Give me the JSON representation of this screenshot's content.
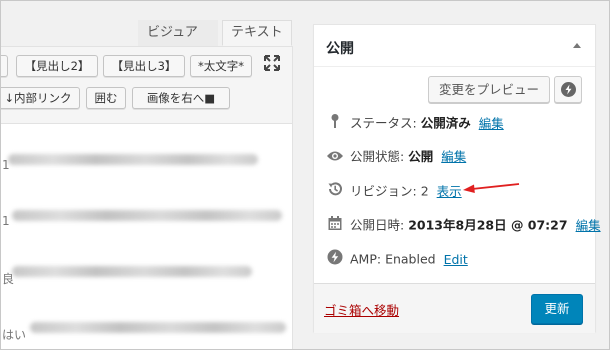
{
  "editor": {
    "tabs": [
      {
        "label": "ビジュアル"
      },
      {
        "label": "テキスト"
      }
    ],
    "quicktags": {
      "row1": [
        "【見出し2】",
        "【見出し3】",
        "*太文字*"
      ],
      "row2": [
        "↓内部リンク",
        "囲む",
        "画像を右へ■"
      ]
    },
    "content_fragments": [
      "1",
      "1",
      "良",
      "はい"
    ]
  },
  "publish_box": {
    "title": "公開",
    "preview_button": "変更をプレビュー",
    "status": {
      "label": "ステータス:",
      "value": "公開済み",
      "link": "編集"
    },
    "visibility": {
      "label": "公開状態:",
      "value": "公開",
      "link": "編集"
    },
    "revisions": {
      "label": "リビジョン:",
      "value": "2",
      "link": "表示"
    },
    "published_on": {
      "label": "公開日時:",
      "value": "2013年8月28日 @ 07:27",
      "link": "編集"
    },
    "amp": {
      "label": "AMP:",
      "value": "Enabled",
      "link": "Edit"
    },
    "trash_link": "ゴミ箱へ移動",
    "update_button": "更新"
  },
  "colors": {
    "link": "#0073aa",
    "primary_button": "#0085ba",
    "trash": "#aa0000",
    "annotation_arrow": "#e02020"
  },
  "icons": [
    "pin-icon",
    "eye-icon",
    "history-icon",
    "calendar-icon",
    "bolt-icon",
    "fullscreen-icon"
  ]
}
